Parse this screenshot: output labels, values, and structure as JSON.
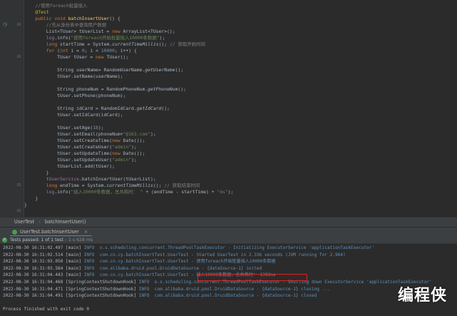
{
  "editor": {
    "lines": [
      {
        "parts": [
          {
            "t": "    "
          },
          {
            "c": "cm",
            "t": "//使用foreach批量插入"
          }
        ]
      },
      {
        "parts": [
          {
            "t": "    "
          },
          {
            "c": "ann",
            "t": "@Test"
          }
        ]
      },
      {
        "parts": [
          {
            "t": "    "
          },
          {
            "c": "kw",
            "t": "public void "
          },
          {
            "c": "fn",
            "t": "batchInsertUser"
          },
          {
            "t": "() {"
          }
        ]
      },
      {
        "parts": [
          {
            "t": "        "
          },
          {
            "c": "cm",
            "t": "//先从身份表中查询用户数据"
          }
        ]
      },
      {
        "parts": [
          {
            "t": "        List<TUser> tUserList = "
          },
          {
            "c": "kw",
            "t": "new "
          },
          {
            "t": "ArrayList<TUser>();"
          }
        ]
      },
      {
        "parts": [
          {
            "t": "        "
          },
          {
            "c": "fld",
            "t": "log"
          },
          {
            "t": ".info("
          },
          {
            "c": "str",
            "t": "\"使用foreach开始批量插入10000条数据\""
          },
          {
            "t": ");"
          }
        ]
      },
      {
        "parts": [
          {
            "t": "        "
          },
          {
            "c": "kw",
            "t": "long "
          },
          {
            "t": "startTime = System."
          },
          {
            "c": "it",
            "t": "currentTimeMillis"
          },
          {
            "t": "(); "
          },
          {
            "c": "cm",
            "t": "// 获取开始时间"
          }
        ]
      },
      {
        "parts": [
          {
            "t": "        "
          },
          {
            "c": "kw",
            "t": "for "
          },
          {
            "t": "("
          },
          {
            "c": "kw",
            "t": "int "
          },
          {
            "t": "i = "
          },
          {
            "c": "num",
            "t": "0"
          },
          {
            "t": "; i < "
          },
          {
            "c": "num",
            "t": "10000"
          },
          {
            "t": "; i++) {"
          }
        ]
      },
      {
        "parts": [
          {
            "t": "            TUser tUser = "
          },
          {
            "c": "kw",
            "t": "new "
          },
          {
            "t": "TUser();"
          }
        ]
      },
      {
        "parts": [
          {
            "t": ""
          }
        ]
      },
      {
        "parts": [
          {
            "t": "            String userName= RandomUserName."
          },
          {
            "c": "it",
            "t": "getUserName"
          },
          {
            "t": "();"
          }
        ]
      },
      {
        "parts": [
          {
            "t": "            tUser.setName(userName);"
          }
        ]
      },
      {
        "parts": [
          {
            "t": ""
          }
        ]
      },
      {
        "parts": [
          {
            "t": "            String phoneNum = RandomPhoneNum."
          },
          {
            "c": "it",
            "t": "getPhoneNum"
          },
          {
            "t": "();"
          }
        ]
      },
      {
        "parts": [
          {
            "t": "            tUser.setPhone(phoneNum);"
          }
        ]
      },
      {
        "parts": [
          {
            "t": ""
          }
        ]
      },
      {
        "parts": [
          {
            "t": "            String idCard = RandomIdCard."
          },
          {
            "c": "it",
            "t": "getIdCard"
          },
          {
            "t": "();"
          }
        ]
      },
      {
        "parts": [
          {
            "t": "            tUser.setIdCard(idCard);"
          }
        ]
      },
      {
        "parts": [
          {
            "t": ""
          }
        ]
      },
      {
        "parts": [
          {
            "t": "            tUser.setAge("
          },
          {
            "c": "num",
            "t": "18"
          },
          {
            "t": ");"
          }
        ]
      },
      {
        "parts": [
          {
            "t": "            tUser.setEmail(phoneNum+"
          },
          {
            "c": "str",
            "t": "\"@163.com\""
          },
          {
            "t": ");"
          }
        ]
      },
      {
        "parts": [
          {
            "t": "            tUser.setCreateTime("
          },
          {
            "c": "kw",
            "t": "new "
          },
          {
            "t": "Date());"
          }
        ]
      },
      {
        "parts": [
          {
            "t": "            tUser.setCreateUser("
          },
          {
            "c": "str",
            "t": "\"admin\""
          },
          {
            "t": ");"
          }
        ]
      },
      {
        "parts": [
          {
            "t": "            tUser.setUpdateTime("
          },
          {
            "c": "kw",
            "t": "new "
          },
          {
            "t": "Date());"
          }
        ]
      },
      {
        "parts": [
          {
            "t": "            tUser.setUpdateUser("
          },
          {
            "c": "str",
            "t": "\"admin\""
          },
          {
            "t": ");"
          }
        ]
      },
      {
        "parts": [
          {
            "t": "            tUserList.add(tUser);"
          }
        ]
      },
      {
        "parts": [
          {
            "t": "        }"
          }
        ]
      },
      {
        "parts": [
          {
            "t": "        "
          },
          {
            "c": "fld",
            "t": "tUserService"
          },
          {
            "t": ".batchInsertUser(tUserList);"
          }
        ]
      },
      {
        "parts": [
          {
            "t": "        "
          },
          {
            "c": "kw",
            "t": "long "
          },
          {
            "t": "endTime = System."
          },
          {
            "c": "it",
            "t": "currentTimeMillis"
          },
          {
            "t": "(); "
          },
          {
            "c": "cm",
            "t": "// 获取结束时间"
          }
        ]
      },
      {
        "parts": [
          {
            "t": "        "
          },
          {
            "c": "fld",
            "t": "log"
          },
          {
            "t": ".info("
          },
          {
            "c": "str",
            "t": "\"插入10000条数据，总共耗时： \""
          },
          {
            "t": " + (endTime - startTime) + "
          },
          {
            "c": "str",
            "t": "\"ms\""
          },
          {
            "t": ");"
          }
        ]
      },
      {
        "parts": [
          {
            "t": "    }"
          }
        ]
      },
      {
        "parts": [
          {
            "t": "}"
          }
        ]
      }
    ]
  },
  "breadcrumb": [
    "UserTest",
    "batchInsertUser()"
  ],
  "run_tab": {
    "label": "UserTest.batchInsertUser",
    "close": "×"
  },
  "status": {
    "text": "Tests passed: 1 of 1 test",
    "time": " – 1 s 628 ms"
  },
  "console": {
    "lines": [
      {
        "dt": "2022-08-30 16:31:02.497",
        "th": " [main] ",
        "lv": "INFO ",
        "cls": " o.s.scheduling.concurrent.ThreadPoolTaskExecutor",
        "msg": " - Initializing ExecutorService 'applicationTaskExecutor'"
      },
      {
        "dt": "2022-08-30 16:31:02.514",
        "th": " [main] ",
        "lv": "INFO ",
        "cls": " com.cn.cy.batchInsertTest.UserTest",
        "msg": " - Started UserTest in 2.336 seconds (JVM running for 2.964)"
      },
      {
        "dt": "2022-08-30 16:31:03.050",
        "th": " [main] ",
        "lv": "INFO ",
        "cls": " com.cn.cy.batchInsertTest.UserTest",
        "msg": " - 使用foreach开始批量插入10000条数据"
      },
      {
        "dt": "2022-08-30 16:31:03.584",
        "th": " [main] ",
        "lv": "INFO ",
        "cls": " com.alibaba.druid.pool.DruidDataSource",
        "msg": " - {dataSource-1} inited"
      },
      {
        "dt": "2022-08-30 16:31:04.443",
        "th": " [main] ",
        "lv": "INFO ",
        "cls": " com.cn.cy.batchInsertTest.UserTest",
        "msg": " - 插入10000条数据，总共耗时： 1392ms"
      },
      {
        "dt": "2022-08-30 16:31:04.468",
        "th": " [SpringContextShutdownHook] ",
        "lv": "INFO ",
        "cls": " o.s.scheduling.concurrent.ThreadPoolTaskExecutor",
        "msg": " - Shutting down ExecutorService 'applicationTaskExecutor'"
      },
      {
        "dt": "2022-08-30 16:31:04.471",
        "th": " [SpringContextShutdownHook] ",
        "lv": "INFO ",
        "cls": " com.alibaba.druid.pool.DruidDataSource",
        "msg": " - {dataSource-1} closing ..."
      },
      {
        "dt": "2022-08-30 16:31:04.491",
        "th": " [SpringContextShutdownHook] ",
        "lv": "INFO ",
        "cls": " com.alibaba.druid.pool.DruidDataSource",
        "msg": " - {dataSource-1} closed"
      }
    ],
    "exit": "Process finished with exit code 0"
  },
  "watermark": "编程侠",
  "colors": {
    "keyword": "#cc7832",
    "comment": "#808080",
    "string": "#6a8759",
    "number": "#6897bb",
    "annotation": "#bbb529",
    "log_info": "#5d91bd",
    "highlight_box": "#e02020",
    "test_pass": "#499c54"
  }
}
